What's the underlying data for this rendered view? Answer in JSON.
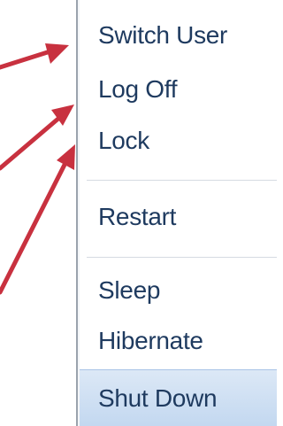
{
  "menu": {
    "items": [
      {
        "label": "Switch User"
      },
      {
        "label": "Log Off"
      },
      {
        "label": "Lock"
      },
      {
        "label": "Restart"
      },
      {
        "label": "Sleep"
      },
      {
        "label": "Hibernate"
      },
      {
        "label": "Shut Down",
        "highlighted": true
      }
    ]
  },
  "colors": {
    "text": "#1e3a5f",
    "highlight": "#c3d8f0",
    "arrow": "#c8313f"
  }
}
